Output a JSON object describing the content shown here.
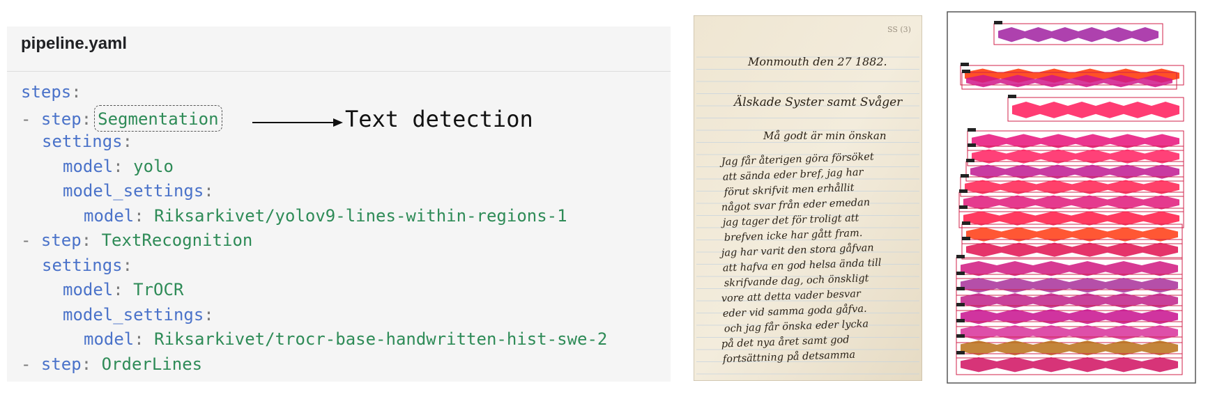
{
  "code_panel": {
    "filename": "pipeline.yaml",
    "lines": {
      "l1_key": "steps",
      "l2_dash": "- ",
      "l2_key": "step",
      "l2_val": "Segmentation",
      "l3_key": "settings",
      "l4_key": "model",
      "l4_val": "yolo",
      "l5_key": "model_settings",
      "l6_key": "model",
      "l6_val": "Riksarkivet/yolov9-lines-within-regions-1",
      "l7_dash": "- ",
      "l7_key": "step",
      "l7_val": "TextRecognition",
      "l8_key": "settings",
      "l9_key": "model",
      "l9_val": "TrOCR",
      "l10_key": "model_settings",
      "l11_key": "model",
      "l11_val": "Riksarkivet/trocr-base-handwritten-hist-swe-2",
      "l12_dash": "- ",
      "l12_key": "step",
      "l12_val": "OrderLines"
    },
    "colors": {
      "key": "#4a72c9",
      "value": "#2e8b57",
      "background": "#f5f5f5"
    }
  },
  "annotation": {
    "label": "Text detection"
  },
  "manuscript": {
    "page_label": "SS (3)",
    "heading_lines": [
      "Monmouth den 27 1882.",
      "Älskade Syster samt Svåger",
      "Må godt är min önskan"
    ],
    "body_lines": [
      "Jag får återigen göra försöket",
      "att sända eder bref, jag har",
      "förut skrifvit men erhållit",
      "något svar från eder emedan",
      "jag tager det för troligt att",
      "brefven icke har gått fram.",
      "jag har varit den stora gåfvan",
      "att hafva en god helsa ända till",
      "skrifvande dag, och önskligt",
      "vore att detta vader besvar",
      "eder vid samma goda gåfva.",
      "och jag får önska eder lycka",
      "på det nya året samt god",
      "fortsättning på detsamma"
    ]
  },
  "segmented_view": {
    "line_colors": [
      "#a020a0",
      "#ff3300",
      "#d0188a",
      "#ff1a5a",
      "#e8107a",
      "#ff2060",
      "#c01890",
      "#ff2050",
      "#e0187a",
      "#ff1844",
      "#ff3a10",
      "#e01050",
      "#d01880",
      "#a8309a",
      "#c02088",
      "#c8108e",
      "#d8309a",
      "#b87018",
      "#d01060"
    ]
  }
}
